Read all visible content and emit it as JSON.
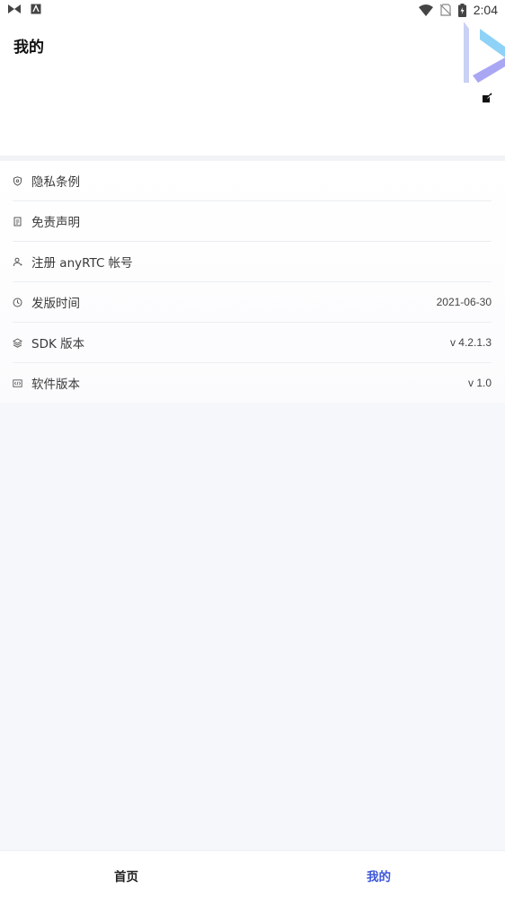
{
  "statusbar": {
    "time": "2:04"
  },
  "header": {
    "title": "我的"
  },
  "menu": [
    {
      "icon": "shield-icon",
      "label": "隐私条例",
      "value": ""
    },
    {
      "icon": "document-icon",
      "label": "免责声明",
      "value": ""
    },
    {
      "icon": "user-add-icon",
      "label": "注册 anyRTC 帐号",
      "value": ""
    },
    {
      "icon": "clock-icon",
      "label": "发版时间",
      "value": "2021-06-30"
    },
    {
      "icon": "layers-icon",
      "label": "SDK 版本",
      "value": "v 4.2.1.3"
    },
    {
      "icon": "code-icon",
      "label": "软件版本",
      "value": "v 1.0"
    }
  ],
  "tabs": {
    "home": "首页",
    "mine": "我的"
  },
  "colors": {
    "accent": "#3d57d8",
    "logo_purple": "#a9a7f4",
    "logo_blue": "#8fd2f7"
  }
}
